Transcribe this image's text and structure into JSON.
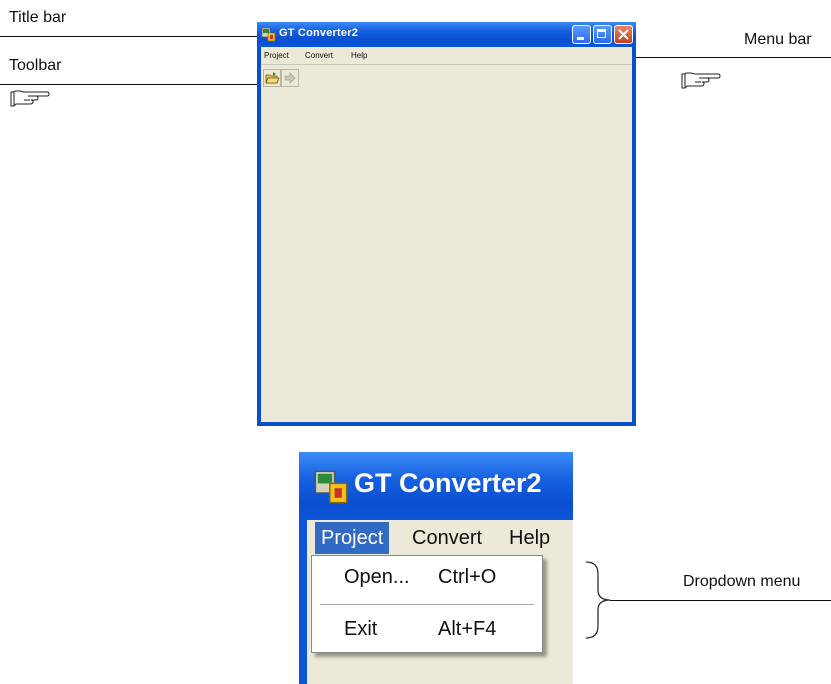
{
  "annotations": {
    "title_bar": "Title bar",
    "toolbar": "Toolbar",
    "menu_bar": "Menu bar",
    "dropdown_menu": "Dropdown menu"
  },
  "window": {
    "title": "GT Converter2",
    "menus": [
      "Project",
      "Convert",
      "Help"
    ]
  },
  "zoom": {
    "title": "GT Converter2",
    "menus": [
      "Project",
      "Convert",
      "Help"
    ],
    "active_menu": "Project",
    "dropdown": [
      {
        "label": "Open...",
        "shortcut": "Ctrl+O"
      },
      {
        "label": "Exit",
        "shortcut": "Alt+F4"
      }
    ]
  },
  "colors": {
    "titlebar_blue": "#0a4fd0",
    "client_bg": "#ece9d8",
    "menu_highlight": "#316ac5",
    "close_button": "#c6401c"
  }
}
